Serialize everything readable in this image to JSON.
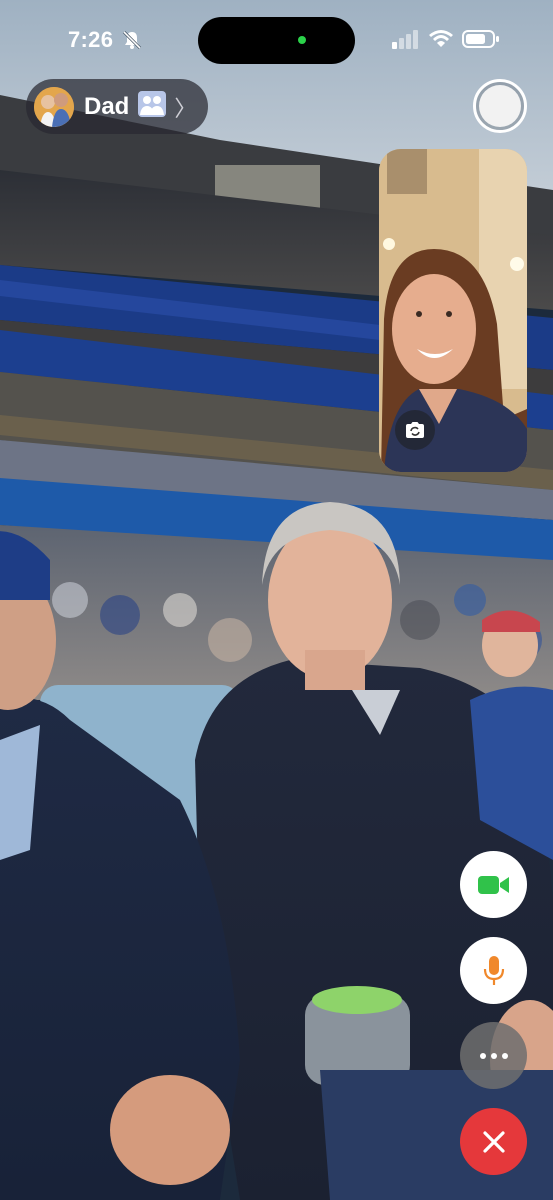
{
  "status_bar": {
    "time": "7:26",
    "icons": [
      "bell-slash-icon",
      "cellular-signal-icon",
      "wifi-icon",
      "battery-icon"
    ]
  },
  "call": {
    "caller_name": "Dad",
    "caller_icons": [
      "people-icon",
      "chevron-right-icon"
    ],
    "chevron": "〉"
  },
  "controls": {
    "icons": [
      "video-camera-icon",
      "microphone-icon",
      "more-icon",
      "end-call-icon"
    ]
  },
  "self_view": {
    "icons": [
      "camera-flip-icon"
    ]
  },
  "colors": {
    "video_accent": "#30c24a",
    "mic_accent": "#f0882b",
    "end_call": "#e5383b",
    "island_dot": "#2bd24a"
  }
}
